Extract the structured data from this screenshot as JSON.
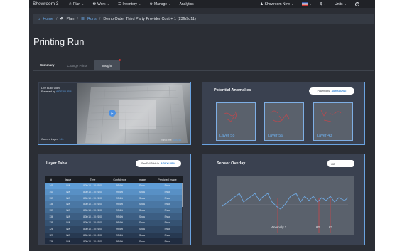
{
  "nav": {
    "brand": "Showroom 3",
    "items": [
      {
        "icon": "plan-icon",
        "glyph": "☘",
        "label": "Plan"
      },
      {
        "icon": "work-icon",
        "glyph": "⚒",
        "label": "Work"
      },
      {
        "icon": "inventory-icon",
        "glyph": "☰",
        "label": "Inventory"
      },
      {
        "icon": "manage-icon",
        "glyph": "⚙",
        "label": "Manage"
      }
    ],
    "analytics": "Analytics",
    "showroom_label": "Showroom New",
    "currency": "$",
    "units": "Units",
    "help_glyph": "?"
  },
  "breadcrumb": {
    "home": "Home",
    "plan": "Plan",
    "runs": "Runs",
    "current": "Demo Order Third Party Provider Cost + 1 (23fb9d11)"
  },
  "page": {
    "title": "Printing Run"
  },
  "tabs": {
    "summary": "Summary",
    "change_prints": "Change Prints",
    "insight": "Insight"
  },
  "video": {
    "title": "Live Build Video",
    "powered_by": "Powered by",
    "ai_brand": "AIDEXLURAI",
    "current_layer_label": "Current Layer:",
    "current_layer_value": "141",
    "runtime_label": "Run Time:",
    "runtime_value": "3:20:51"
  },
  "anomalies": {
    "title": "Potential Anomalies",
    "powered_by": "Powered by",
    "ai_brand": "AIDEXLURAI",
    "cards": [
      {
        "label": "Layer 58"
      },
      {
        "label": "Layer 56"
      },
      {
        "label": "Layer 43"
      }
    ]
  },
  "layer_table": {
    "title": "Layer Table",
    "full_table": "See Full Table In",
    "ai_brand": "AIDEXLURAI",
    "columns": [
      "#",
      "Issue",
      "Time",
      "Confidence",
      "Image",
      "Predicted Image"
    ],
    "rows": [
      {
        "n": "141",
        "issue": "N/A",
        "time": "8:30:10 – 10:21:00",
        "conf": "99.6%",
        "image": "Show",
        "pred": "Show"
      },
      {
        "n": "140",
        "issue": "N/A",
        "time": "8:30:10 – 10:21:00",
        "conf": "99.6%",
        "image": "Show",
        "pred": "Show"
      },
      {
        "n": "139",
        "issue": "N/A",
        "time": "8:30:10 – 10:21:00",
        "conf": "99.6%",
        "image": "Show",
        "pred": "Show"
      },
      {
        "n": "138",
        "issue": "N/A",
        "time": "8:30:10 – 10:21:00",
        "conf": "99.6%",
        "image": "Show",
        "pred": "Show"
      },
      {
        "n": "137",
        "issue": "N/A",
        "time": "8:30:10 – 10:21:00",
        "conf": "99.6%",
        "image": "Show",
        "pred": "Show"
      },
      {
        "n": "136",
        "issue": "N/A",
        "time": "8:30:10 – 10:21:00",
        "conf": "99.6%",
        "image": "Show",
        "pred": "Show"
      },
      {
        "n": "135",
        "issue": "N/A",
        "time": "8:30:10 – 10:21:00",
        "conf": "99.6%",
        "image": "Show",
        "pred": "Show"
      },
      {
        "n": "128",
        "issue": "N/A",
        "time": "8:30:10 – 10:21:00",
        "conf": "99.6%",
        "image": "Show",
        "pred": "Show"
      },
      {
        "n": "127",
        "issue": "N/A",
        "time": "8:30:10 – 10:19:00",
        "conf": "99.6%",
        "image": "Show",
        "pred": "Show"
      },
      {
        "n": "126",
        "issue": "N/A",
        "time": "8:30:10 – 10:19:00",
        "conf": "99.6%",
        "image": "Show",
        "pred": "Show"
      }
    ]
  },
  "sensor": {
    "title": "Sensor Overlay",
    "selected": "O2",
    "annotations": [
      "Anomaly 1",
      "#2",
      "#3"
    ]
  },
  "colors": {
    "accent": "#6aa9e8",
    "panel_border": "#6aa3e0",
    "anomaly_line": "#c8454a",
    "trace": "#6fa8e0"
  }
}
